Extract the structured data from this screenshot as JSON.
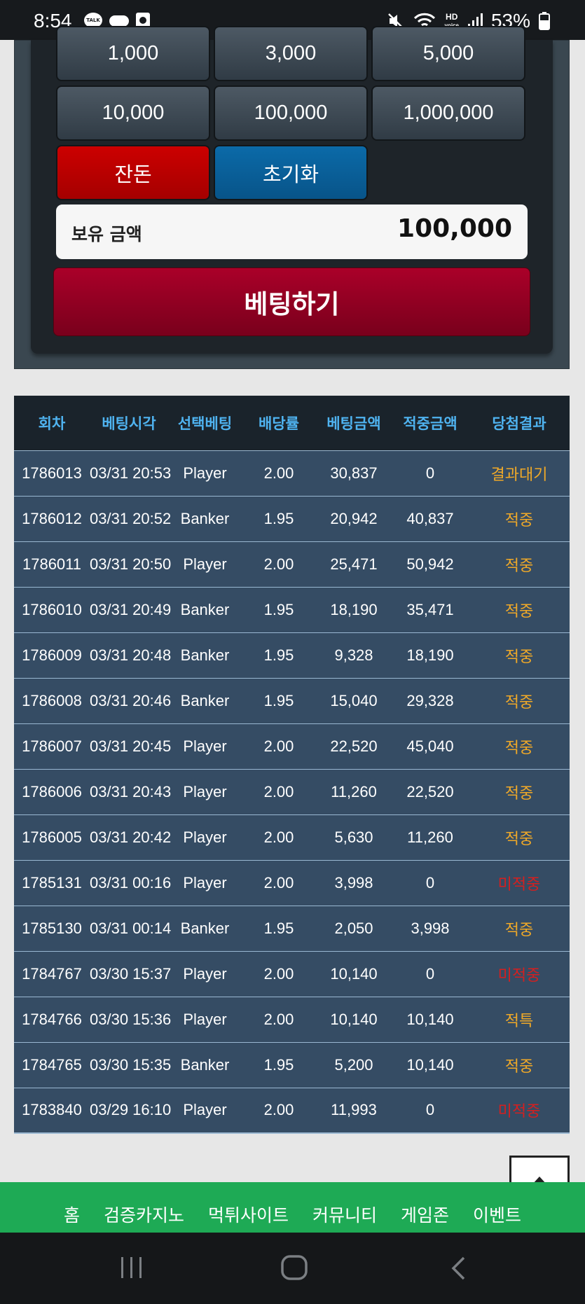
{
  "status_bar": {
    "time": "8:54",
    "talk_label": "TALK",
    "battery_percent": "53%",
    "hd_label": "HD",
    "voice_label": "voice",
    "left_icons": [
      "talk-icon",
      "cloud-icon",
      "notification-box-icon"
    ],
    "right_icons": [
      "mute-icon",
      "wifi-icon",
      "hd-voice-icon",
      "signal-icon",
      "battery-icon"
    ]
  },
  "chips": {
    "row1": [
      "1,000",
      "3,000",
      "5,000"
    ],
    "row2": [
      "10,000",
      "100,000",
      "1,000,000"
    ],
    "change_label": "잔돈",
    "reset_label": "초기화"
  },
  "balance": {
    "label": "보유 금액",
    "value": "100,000"
  },
  "bet_button_label": "베팅하기",
  "table": {
    "headers": [
      "회차",
      "베팅시각",
      "선택베팅",
      "배당률",
      "베팅금액",
      "적중금액",
      "당첨결과"
    ],
    "rows": [
      [
        "1786013",
        "03/31 20:53",
        "Player",
        "2.00",
        "30,837",
        "0",
        "결과대기"
      ],
      [
        "1786012",
        "03/31 20:52",
        "Banker",
        "1.95",
        "20,942",
        "40,837",
        "적중"
      ],
      [
        "1786011",
        "03/31 20:50",
        "Player",
        "2.00",
        "25,471",
        "50,942",
        "적중"
      ],
      [
        "1786010",
        "03/31 20:49",
        "Banker",
        "1.95",
        "18,190",
        "35,471",
        "적중"
      ],
      [
        "1786009",
        "03/31 20:48",
        "Banker",
        "1.95",
        "9,328",
        "18,190",
        "적중"
      ],
      [
        "1786008",
        "03/31 20:46",
        "Banker",
        "1.95",
        "15,040",
        "29,328",
        "적중"
      ],
      [
        "1786007",
        "03/31 20:45",
        "Player",
        "2.00",
        "22,520",
        "45,040",
        "적중"
      ],
      [
        "1786006",
        "03/31 20:43",
        "Player",
        "2.00",
        "11,260",
        "22,520",
        "적중"
      ],
      [
        "1786005",
        "03/31 20:42",
        "Player",
        "2.00",
        "5,630",
        "11,260",
        "적중"
      ],
      [
        "1785131",
        "03/31 00:16",
        "Player",
        "2.00",
        "3,998",
        "0",
        "미적중"
      ],
      [
        "1785130",
        "03/31 00:14",
        "Banker",
        "1.95",
        "2,050",
        "3,998",
        "적중"
      ],
      [
        "1784767",
        "03/30 15:37",
        "Player",
        "2.00",
        "10,140",
        "0",
        "미적중"
      ],
      [
        "1784766",
        "03/30 15:36",
        "Player",
        "2.00",
        "10,140",
        "10,140",
        "적특"
      ],
      [
        "1784765",
        "03/30 15:35",
        "Banker",
        "1.95",
        "5,200",
        "10,140",
        "적중"
      ],
      [
        "1783840",
        "03/29 16:10",
        "Player",
        "2.00",
        "11,993",
        "0",
        "미적중"
      ]
    ]
  },
  "bottom_nav": [
    "홈",
    "검증카지노",
    "먹튀사이트",
    "커뮤니티",
    "게임존",
    "이벤트"
  ],
  "colors": {
    "result_pending": "#f0a928",
    "result_hit": "#f0a928",
    "result_miss": "#d51f1f",
    "header_text": "#4fb3f0",
    "nav_bg": "#1eaa55"
  }
}
